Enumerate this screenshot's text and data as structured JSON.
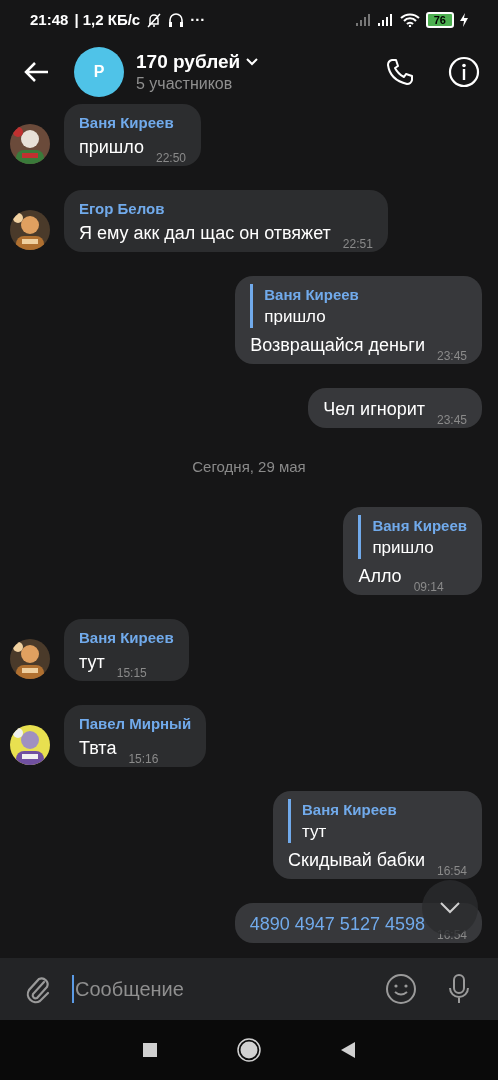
{
  "status_bar": {
    "time": "21:48",
    "speed": "| 1,2 КБ/с",
    "more": "···",
    "battery": "76"
  },
  "header": {
    "avatar_letter": "Р",
    "title": "170 рублей",
    "subtitle": "5 участников"
  },
  "messages": [
    {
      "kind": "message",
      "outgoing": false,
      "author": "Ваня Киреев",
      "text": "пришло",
      "time": "22:50"
    },
    {
      "kind": "message",
      "outgoing": false,
      "author": "Егор Белов",
      "text": "Я ему акк дал щас он отвяжет",
      "time": "22:51"
    },
    {
      "kind": "message",
      "outgoing": true,
      "reply": {
        "author": "Ваня Киреев",
        "text": "пришло"
      },
      "text": "Возвращайся деньги",
      "time": "23:45"
    },
    {
      "kind": "message",
      "outgoing": true,
      "text": "Чел игнорит",
      "time": "23:45"
    },
    {
      "kind": "date",
      "text": "Сегодня, 29 мая"
    },
    {
      "kind": "message",
      "outgoing": true,
      "reply": {
        "author": "Ваня Киреев",
        "text": "пришло"
      },
      "text": "Алло",
      "time": "09:14"
    },
    {
      "kind": "message",
      "outgoing": false,
      "author": "Ваня Киреев",
      "text": "тут",
      "time": "15:15"
    },
    {
      "kind": "message",
      "outgoing": false,
      "author": "Павел Мирный",
      "text": "Твта",
      "time": "15:16"
    },
    {
      "kind": "message",
      "outgoing": true,
      "reply": {
        "author": "Ваня Киреев",
        "text": "тут"
      },
      "text": "Скидывай бабки",
      "time": "16:54"
    },
    {
      "kind": "message",
      "outgoing": true,
      "link": true,
      "text": "4890 4947 5127 4598",
      "time": "16:54"
    }
  ],
  "composer": {
    "placeholder": "Сообщение"
  }
}
